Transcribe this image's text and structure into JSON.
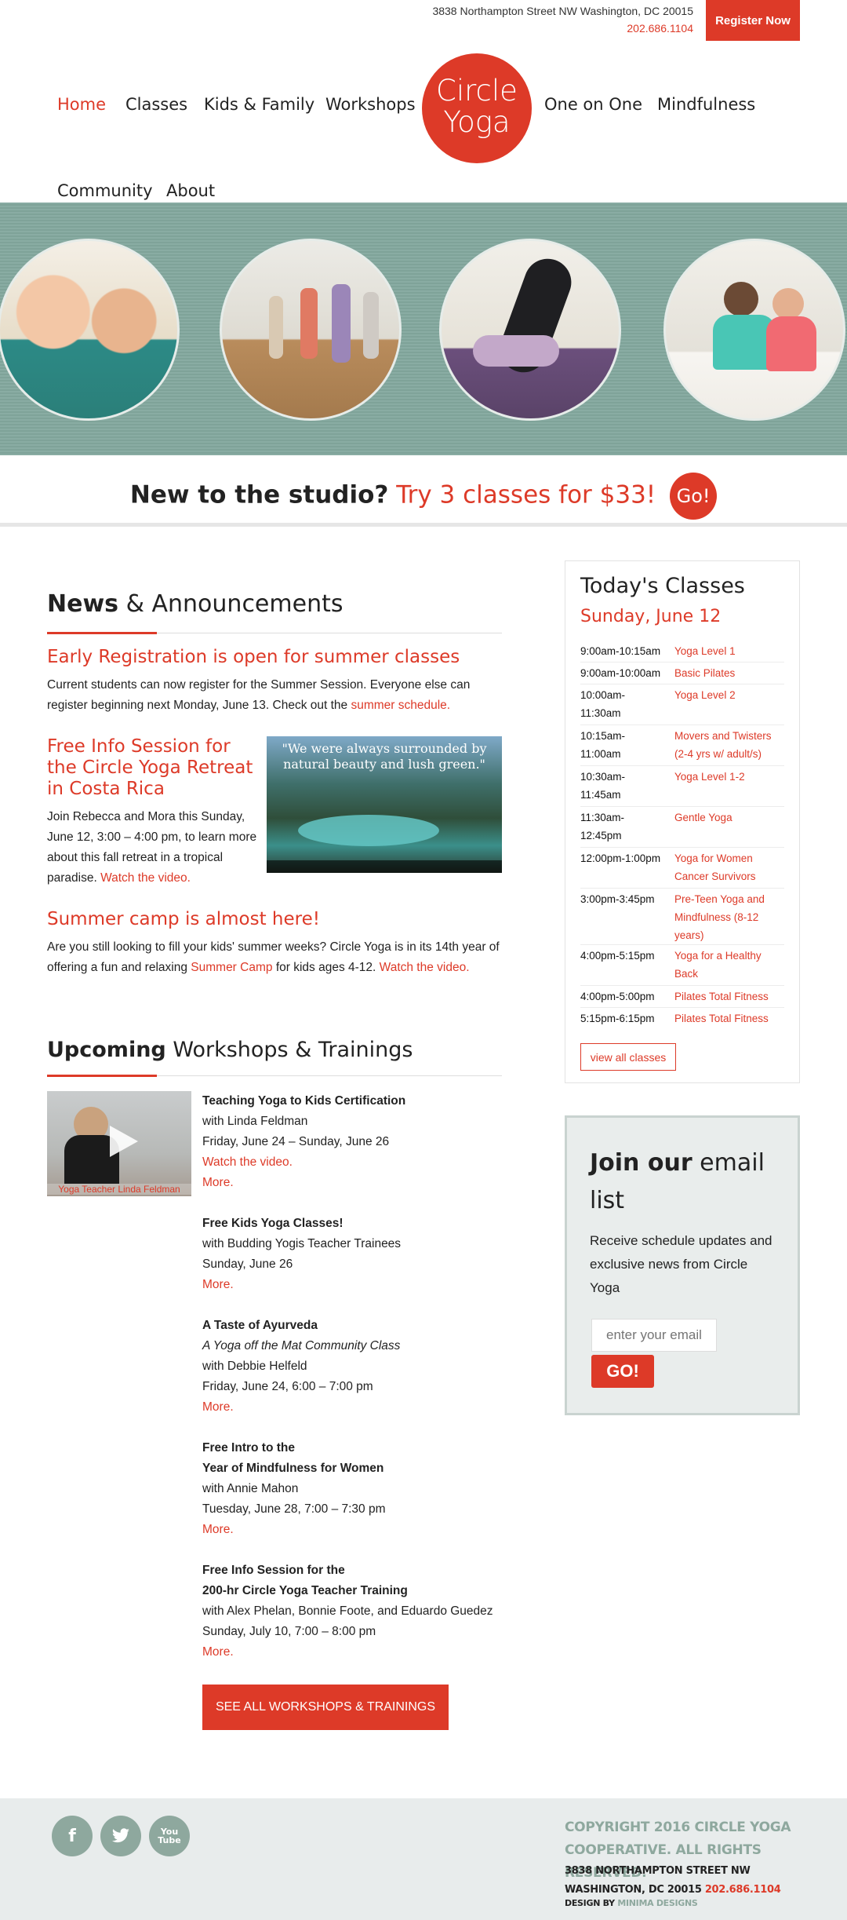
{
  "header": {
    "address": "3838 Northampton Street NW Washington, DC 20015",
    "phone": "202.686.1104",
    "register_label": "Register Now",
    "logo_line1": "Circle",
    "logo_line2": "Yoga",
    "nav": [
      "Home",
      "Classes",
      "Kids & Family",
      "Workshops",
      "One on One",
      "Mindfulness",
      "Community",
      "About"
    ]
  },
  "banner": {
    "photos": [
      "kids-namaste-photo",
      "dance-class-photo",
      "yoga-pose-photo",
      "partner-yoga-photo"
    ]
  },
  "promo": {
    "lead": "New to the studio?",
    "offer": "Try 3 classes for $33!",
    "go": "Go!"
  },
  "news": {
    "title_bold": "News",
    "title_rest": "& Announcements",
    "items": [
      {
        "heading": "Early Registration is open for summer classes",
        "text": "Current students can now register for the Summer Session. Everyone else can register beginning next Monday, June 13. Check out the",
        "link": "summer schedule."
      },
      {
        "heading": "Free Info Session for the Circle Yoga Retreat in Costa Rica",
        "text": "Join Rebecca and Mora this Sunday, June 12, 3:00 – 4:00 pm, to learn more about this fall retreat in a tropical paradise.",
        "link": "Watch the video.",
        "video_quote": "\"We were always surrounded by natural beauty and lush green.\""
      },
      {
        "heading": "Summer camp is almost here!",
        "text_a": "Are you still looking to fill your kids' summer weeks? Circle Yoga is in its 14th year of offering a fun and relaxing",
        "link_a": "Summer Camp",
        "text_b": "for kids ages 4-12.",
        "link_b": "Watch the video."
      }
    ]
  },
  "workshops": {
    "title_bold": "Upcoming",
    "title_rest": "Workshops & Trainings",
    "thumb_caption": "Yoga Teacher Linda Feldman",
    "items": [
      {
        "title": "Teaching Yoga to Kids Certification",
        "with": "with Linda Feldman",
        "date": "Friday, June 24 – Sunday, June 26",
        "video": "Watch the video.",
        "more": "More."
      },
      {
        "title": "Free Kids Yoga Classes!",
        "with": "with Budding Yogis Teacher Trainees",
        "date": "Sunday, June 26",
        "more": "More."
      },
      {
        "title": "A Taste of Ayurveda",
        "subtitle": "A Yoga off the Mat Community Class",
        "with": "with Debbie Helfeld",
        "date": "Friday, June 24, 6:00 – 7:00 pm",
        "more": "More."
      },
      {
        "title1": "Free Intro to the",
        "title2": "Year of Mindfulness for Women",
        "with": "with Annie Mahon",
        "date": "Tuesday, June 28, 7:00 – 7:30 pm",
        "more": "More."
      },
      {
        "title1": "Free Info Session for the",
        "title2": "200-hr Circle Yoga Teacher Training",
        "with": "with Alex Phelan, Bonnie Foote, and Eduardo Guedez",
        "date": "Sunday, July 10, 7:00 – 8:00 pm",
        "more": "More."
      }
    ],
    "see_all": "SEE ALL WORKSHOPS & TRAININGS"
  },
  "today": {
    "title": "Today's Classes",
    "date": "Sunday, June 12",
    "classes": [
      {
        "time": "9:00am-10:15am",
        "name": "Yoga Level 1"
      },
      {
        "time": "9:00am-10:00am",
        "name": "Basic Pilates"
      },
      {
        "time": "10:00am-11:30am",
        "name": "Yoga Level 2"
      },
      {
        "time": "10:15am-11:00am",
        "name": "Movers and Twisters (2-4 yrs w/ adult/s)"
      },
      {
        "time": "10:30am-11:45am",
        "name": "Yoga Level 1-2"
      },
      {
        "time": "11:30am-12:45pm",
        "name": "Gentle Yoga"
      },
      {
        "time": "12:00pm-1:00pm",
        "name": "Yoga for Women Cancer Survivors"
      },
      {
        "time": "3:00pm-3:45pm",
        "name": "Pre-Teen Yoga and Mindfulness (8-12 years)"
      },
      {
        "time": "4:00pm-5:15pm",
        "name": "Yoga for a Healthy Back"
      },
      {
        "time": "4:00pm-5:00pm",
        "name": "Pilates Total Fitness"
      },
      {
        "time": "5:15pm-6:15pm",
        "name": "Pilates Total Fitness"
      }
    ],
    "view_all": "view all classes"
  },
  "email": {
    "title_bold": "Join our",
    "title_rest": "email list",
    "desc": "Receive schedule updates and exclusive news from Circle Yoga",
    "placeholder": "enter your email",
    "go": "GO!"
  },
  "footer": {
    "social": [
      "f",
      "t",
      "You Tube"
    ],
    "copyright": "COPYRIGHT 2016 CIRCLE YOGA COOPERATIVE. ALL RIGHTS RESERVED.",
    "address": "3838 NORTHAMPTON STREET NW   WASHINGTON, DC 20015",
    "phone": "202.686.1104",
    "design_by": "DESIGN BY",
    "designer": "MINIMA DESIGNS"
  },
  "colors": {
    "accent": "#dd3a28",
    "sage": "#83a89e",
    "footer_bg": "#e8ecec"
  }
}
